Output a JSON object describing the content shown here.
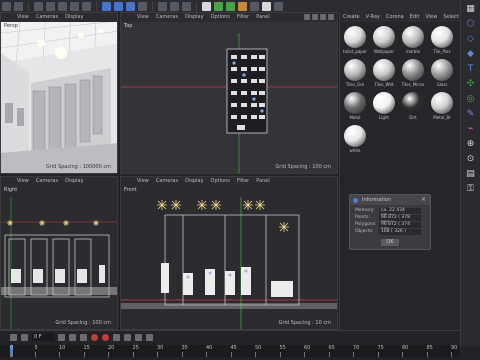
{
  "viewports": {
    "perspective": {
      "name": "Persp",
      "grid": "Grid Spacing : 100000 cm"
    },
    "top": {
      "name": "Top",
      "grid": "Grid Spacing : 100 cm"
    },
    "right": {
      "name": "Right",
      "grid": "Grid Spacing : 100 cm"
    },
    "front": {
      "name": "Front",
      "grid": "Grid Spacing : 10 cm"
    },
    "menu": [
      "View",
      "Cameras",
      "Display",
      "Options",
      "Filter",
      "Panel"
    ]
  },
  "material_browser": {
    "menu": [
      "Create",
      "V-Ray",
      "Corona",
      "Edit",
      "View",
      "Select"
    ],
    "materials": [
      {
        "label": "toilet_paper",
        "color": "#d9d9d9"
      },
      {
        "label": "Wallpaper",
        "color": "#cfcfcf"
      },
      {
        "label": "marble",
        "color": "#bdbdbd"
      },
      {
        "label": "Tile_Plas",
        "color": "#e2e2e2"
      },
      {
        "label": "Tiles_Gre",
        "color": "#b8b8b8"
      },
      {
        "label": "Tiles_Wht",
        "color": "#c9c9c9"
      },
      {
        "label": "Tiles_Mirror",
        "color": "#8a8a8a"
      },
      {
        "label": "Glass",
        "color": "#9a9a9a"
      },
      {
        "label": "Metal",
        "color": "#6a6a6a"
      },
      {
        "label": "Light",
        "color": "#f2f2f2"
      },
      {
        "label": "Dirt",
        "color": "#2c2c2c"
      },
      {
        "label": "Metal_Br",
        "color": "#d0d0d0"
      },
      {
        "label": "white",
        "color": "#e6e6e6"
      }
    ]
  },
  "info_dialog": {
    "title": "Information",
    "close": "×",
    "rows": [
      {
        "key": "Memory:",
        "value": "ca. 22 434 KByte"
      },
      {
        "key": "Points:",
        "value": "96 872 ( 378 906 )"
      },
      {
        "key": "Polygons:",
        "value": "96 872 ( 374 576 )"
      },
      {
        "key": "Objects:",
        "value": "168 ( 326 )"
      }
    ],
    "ok": "OK"
  },
  "timeline": {
    "frame": "0 F",
    "ticks": [
      "0",
      "5",
      "10",
      "15",
      "20",
      "25",
      "30",
      "35",
      "40",
      "45",
      "50",
      "55",
      "60",
      "65",
      "70",
      "75",
      "80",
      "85",
      "90"
    ]
  },
  "colors": {
    "accent": "#4a82d8",
    "record": "#c43b3b"
  }
}
